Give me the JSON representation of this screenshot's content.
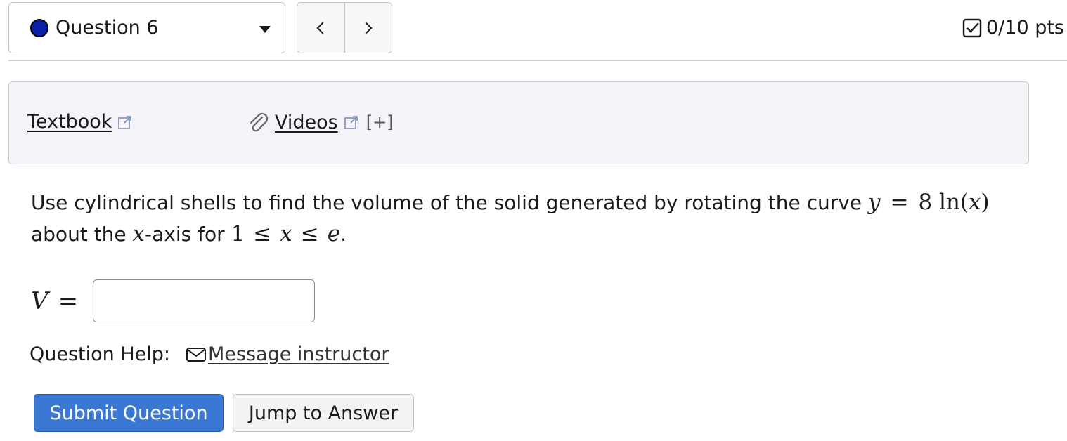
{
  "header": {
    "question_label": "Question 6",
    "prev_label": "<",
    "next_label": ">",
    "points": "0/10 pts",
    "status_dot_color": "#0a1fa8"
  },
  "resources": {
    "textbook_label": "Textbook",
    "videos_label": "Videos",
    "expand_label": "[+]"
  },
  "question": {
    "text_part1": "Use cylindrical shells to find the volume of the solid generated by rotating the curve ",
    "equation_y": "y",
    "equation_eq": "=",
    "equation_rhs": "8 ln(",
    "equation_x": "x",
    "equation_close": ")",
    "text_part2": "about the ",
    "axis_var": "x",
    "text_part3": "-axis for ",
    "bound_low": "1",
    "le1": "≤",
    "bound_var": "x",
    "le2": "≤",
    "bound_high": "e",
    "text_end": "."
  },
  "answer": {
    "label_var": "V",
    "label_eq": "=",
    "value": "",
    "placeholder": ""
  },
  "help": {
    "label": "Question Help:",
    "message_label": "Message instructor"
  },
  "buttons": {
    "submit": "Submit Question",
    "jump": "Jump to Answer"
  }
}
